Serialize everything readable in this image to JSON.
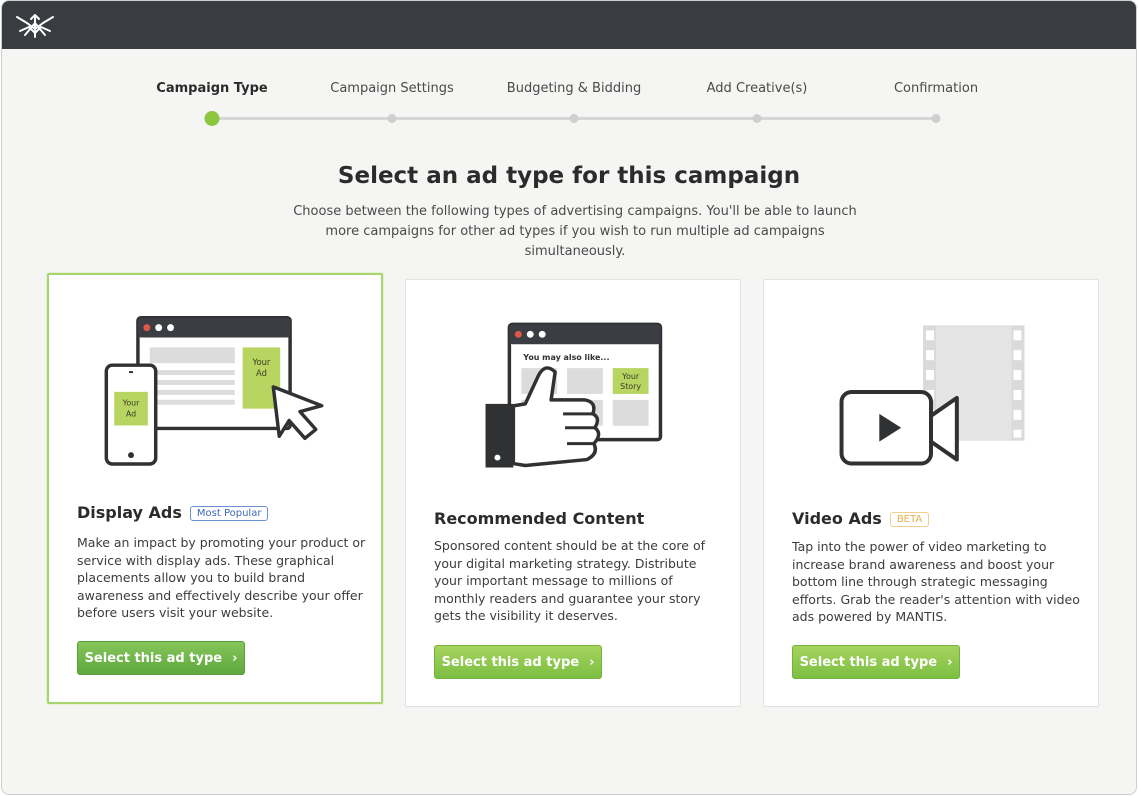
{
  "stepper": {
    "steps": [
      {
        "label": "Campaign Type",
        "active": true
      },
      {
        "label": "Campaign Settings",
        "active": false
      },
      {
        "label": "Budgeting & Bidding",
        "active": false
      },
      {
        "label": "Add Creative(s)",
        "active": false
      },
      {
        "label": "Confirmation",
        "active": false
      }
    ],
    "progress_step": 1
  },
  "main": {
    "title": "Select an ad type for this campaign",
    "subtitle": "Choose between the following types of advertising campaigns. You'll be able to launch more campaigns for other ad types if you wish to run multiple ad campaigns simultaneously."
  },
  "cards": [
    {
      "title": "Display Ads",
      "badge": "Most Popular",
      "description": "Make an impact by promoting your product or service with display ads. These graphical placements allow you to build brand awareness and effectively describe your offer before users visit your website.",
      "button": "Select this ad type",
      "illustration": {
        "ad_label_1": "Your",
        "ad_label_2": "Ad"
      },
      "selected": true
    },
    {
      "title": "Recommended Content",
      "description": "Sponsored content should be at the core of your digital marketing strategy. Distribute your important message to millions of monthly readers and guarantee your story gets the visibility it deserves.",
      "button": "Select this ad type",
      "illustration": {
        "heading": "You may also like...",
        "story_label_1": "Your",
        "story_label_2": "Story"
      },
      "selected": false
    },
    {
      "title": "Video Ads",
      "badge": "BETA",
      "description": "Tap into the power of video marketing to increase brand awareness and boost your bottom line through strategic messaging efforts. Grab the reader's attention with video ads powered by MANTIS.",
      "button": "Select this ad type",
      "selected": false
    }
  ],
  "colors": {
    "topbar": "#393c41",
    "accent_green": "#8dc63f",
    "badge_blue": "#3b69b8",
    "badge_beta": "#e0b24a"
  },
  "icons": [
    "mantis-logo-icon",
    "chevron-right-icon",
    "browser-window-icon",
    "phone-icon",
    "cursor-arrow-icon",
    "thumbs-up-icon",
    "video-camera-icon",
    "film-strip-icon"
  ]
}
